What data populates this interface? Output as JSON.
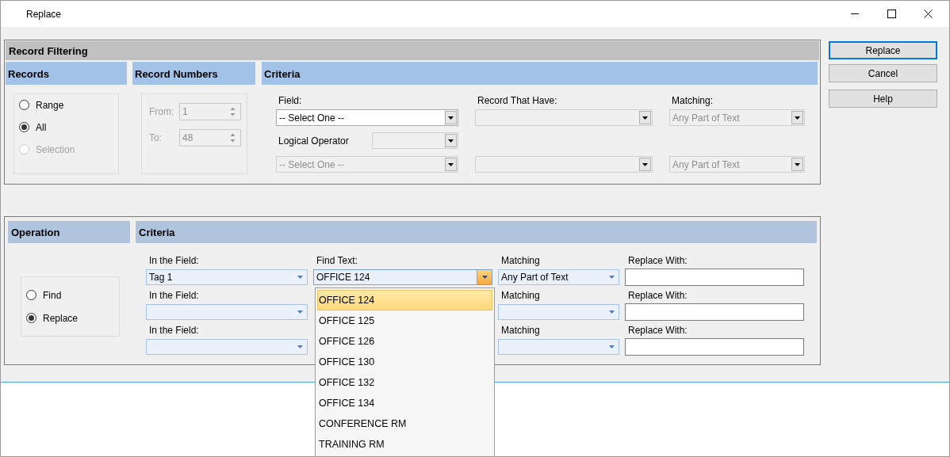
{
  "window": {
    "title": "Replace"
  },
  "record_filtering": {
    "title": "Record Filtering",
    "records": {
      "title": "Records",
      "options": [
        {
          "label": "Range",
          "selected": false,
          "disabled": false
        },
        {
          "label": "All",
          "selected": true,
          "disabled": false
        },
        {
          "label": "Selection",
          "selected": false,
          "disabled": true
        }
      ]
    },
    "record_numbers": {
      "title": "Record Numbers",
      "disabled": true,
      "from": {
        "label": "From:",
        "value": "1"
      },
      "to": {
        "label": "To:",
        "value": "48"
      }
    },
    "criteria": {
      "title": "Criteria",
      "field_label": "Field:",
      "records_label": "Record That Have:",
      "matching_label": "Matching:",
      "logical_operator": {
        "label": "Logical Operator",
        "disabled": true
      },
      "rows": [
        {
          "field": {
            "value": "-- Select One --",
            "disabled": false
          },
          "records_that_have": {
            "disabled": true
          },
          "matching": {
            "value": "Any Part of Text",
            "disabled": true
          }
        },
        {
          "field": {
            "value": "-- Select One --",
            "disabled": true
          },
          "records_that_have": {
            "disabled": true
          },
          "matching": {
            "value": "Any Part of Text",
            "disabled": true
          }
        }
      ]
    }
  },
  "buttons": [
    {
      "label": "Replace",
      "default": true
    },
    {
      "label": "Cancel",
      "default": false
    },
    {
      "label": "Help",
      "default": false
    }
  ],
  "operation": {
    "title": "Operation",
    "options": [
      {
        "label": "Find",
        "selected": false
      },
      {
        "label": "Replace",
        "selected": true
      }
    ]
  },
  "replace_criteria": {
    "title": "Criteria",
    "rows": [
      {
        "field_label": "In the Field:",
        "field": {
          "value": "Tag 1"
        },
        "find_label": "Find Text:",
        "find": {
          "value": "OFFICE 124",
          "open": true
        },
        "matching_label": "Matching",
        "matching": {
          "value": "Any Part of Text"
        },
        "replace_label": "Replace With:"
      },
      {
        "field_label": "In the Field:",
        "field": {},
        "matching_label": "Matching",
        "matching": {},
        "replace_label": "Replace With:"
      },
      {
        "field_label": "In the Field:",
        "field": {},
        "matching_label": "Matching",
        "matching": {},
        "replace_label": "Replace With:"
      }
    ]
  },
  "dropdown": {
    "items": [
      {
        "label": "OFFICE 124",
        "selected": true
      },
      {
        "label": "OFFICE 125",
        "selected": false
      },
      {
        "label": "OFFICE 126",
        "selected": false
      },
      {
        "label": "OFFICE 130",
        "selected": false
      },
      {
        "label": "OFFICE 132",
        "selected": false
      },
      {
        "label": "OFFICE 134",
        "selected": false
      },
      {
        "label": "CONFERENCE RM",
        "selected": false
      },
      {
        "label": "TRAINING RM",
        "selected": false
      }
    ]
  }
}
